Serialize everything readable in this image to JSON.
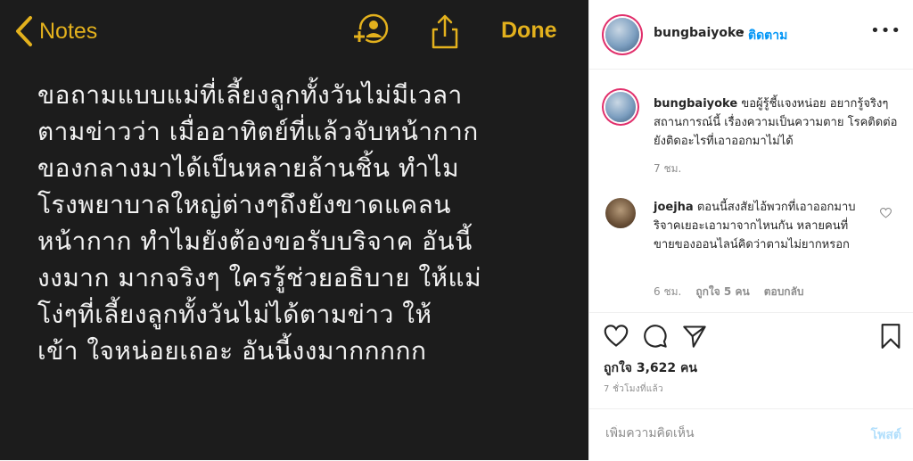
{
  "media": {
    "back_label": "Notes",
    "done_label": "Done",
    "icons": {
      "back": "chevron-left-icon",
      "add_person": "add-person-icon",
      "share": "share-icon"
    },
    "accent": "#e3b11d",
    "note_lines": [
      "ขอถามแบบแม่ที่เลี้ยงลูกทั้งวันไม่มีเวลา",
      "ตามข่าวว่า เมื่ออาทิตย์ที่แล้วจับหน้ากาก",
      "ของกลางมาได้เป็นหลายล้านชิ้น ทำไม",
      "โรงพยาบาลใหญ่ต่างๆถึงยังขาดแคลน",
      "หน้ากาก ทำไมยังต้องขอรับบริจาค อันนี้",
      "งงมาก มากจริงๆ ใครรู้ช่วยอธิบาย ให้แม่",
      "โง่ๆที่เลี้ยงลูกทั้งวันไม่ได้ตามข่าว ให้",
      "เข้า ใจหน่อยเถอะ อันนี้งงมากกกกก"
    ]
  },
  "header": {
    "username": "bungbaiyoke",
    "separator": "•",
    "follow_label": "ติดตาม",
    "more_icon": "more-horizontal-icon"
  },
  "caption": {
    "username": "bungbaiyoke",
    "text": "ขอผู้รู้ชี้แจงหน่อย อยากรู้จริงๆ สถานการณ์นี้ เรื่องความเป็นความตาย โรคติดต่อ ยังติดอะไรที่เอาออกมาไม่ได้",
    "time": "7 ชม."
  },
  "comment": {
    "username": "joejha",
    "text": "ตอนนี้สงสัยไอ้พวกที่เอาออกมาบริจาคเยอะเอามาจากไหนกัน หลายคนที่ขายของออนไลน์คิดว่าตามไม่ยากหรอก",
    "time": "6 ชม.",
    "likes": "ถูกใจ 5 คน",
    "reply_label": "ตอบกลับ",
    "heart_icon": "heart-outline-icon"
  },
  "actions": {
    "icons": [
      "heart-icon",
      "comment-icon",
      "send-icon",
      "bookmark-icon"
    ],
    "likes_text": "ถูกใจ 3,622 คน",
    "posted_ago": "7 ชั่วโมงที่แล้ว"
  },
  "comment_box": {
    "placeholder": "เพิ่มความคิดเห็น",
    "post_label": "โพสต์"
  }
}
